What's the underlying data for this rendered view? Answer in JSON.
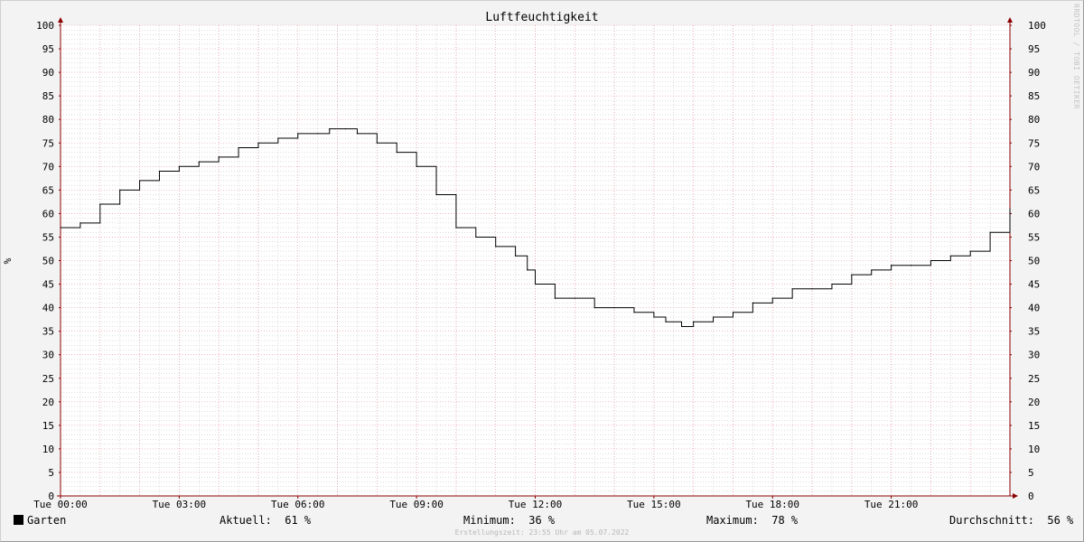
{
  "chart_data": {
    "type": "line",
    "title": "Luftfeuchtigkeit",
    "ylabel": "%",
    "xlabel": "",
    "ylim": [
      0,
      100
    ],
    "xlim": [
      0,
      24
    ],
    "y_ticks": [
      0,
      5,
      10,
      15,
      20,
      25,
      30,
      35,
      40,
      45,
      50,
      55,
      60,
      65,
      70,
      75,
      80,
      85,
      90,
      95,
      100
    ],
    "x_ticks": [
      {
        "x": 0,
        "label": "Tue 00:00"
      },
      {
        "x": 3,
        "label": "Tue 03:00"
      },
      {
        "x": 6,
        "label": "Tue 06:00"
      },
      {
        "x": 9,
        "label": "Tue 09:00"
      },
      {
        "x": 12,
        "label": "Tue 12:00"
      },
      {
        "x": 15,
        "label": "Tue 15:00"
      },
      {
        "x": 18,
        "label": "Tue 18:00"
      },
      {
        "x": 21,
        "label": "Tue 21:00"
      }
    ],
    "grid": true,
    "legend_position": "bottom-left",
    "colors": {
      "line": "#000000",
      "major_grid": "#e48a9a",
      "minor_grid": "#b8b8b8",
      "axis": "#8b0000",
      "plot_bg": "#ffffff"
    },
    "series": [
      {
        "name": "Garten",
        "color": "#000000",
        "x": [
          0,
          0.5,
          1.0,
          1.5,
          2.0,
          2.5,
          3.0,
          3.5,
          4.0,
          4.5,
          5.0,
          5.5,
          6.0,
          6.5,
          6.8,
          7.2,
          7.5,
          8.0,
          8.5,
          9.0,
          9.5,
          10.0,
          10.5,
          11.0,
          11.5,
          11.8,
          12.0,
          12.5,
          13.0,
          13.5,
          14.0,
          14.5,
          15.0,
          15.3,
          15.7,
          16.0,
          16.5,
          17.0,
          17.5,
          18.0,
          18.5,
          19.0,
          19.5,
          20.0,
          20.5,
          21.0,
          21.5,
          22.0,
          22.5,
          23.0,
          23.5,
          24.0
        ],
        "y": [
          57,
          58,
          62,
          65,
          67,
          69,
          70,
          71,
          72,
          74,
          75,
          76,
          77,
          77,
          78,
          78,
          77,
          75,
          73,
          70,
          64,
          57,
          55,
          53,
          51,
          48,
          45,
          42,
          42,
          40,
          40,
          39,
          38,
          37,
          36,
          37,
          38,
          39,
          41,
          42,
          44,
          44,
          45,
          47,
          48,
          49,
          49,
          50,
          51,
          52,
          56,
          61
        ]
      }
    ]
  },
  "legend": {
    "series_name": "Garten",
    "current_label": "Aktuell:",
    "current_value": "61 %",
    "min_label": "Minimum:",
    "min_value": "36 %",
    "max_label": "Maximum:",
    "max_value": "78 %",
    "avg_label": "Durchschnitt:",
    "avg_value": "56 %"
  },
  "footer": "Erstellungszeit: 23:55 Uhr am 05.07.2022",
  "watermark": "RRDTOOL / TOBI OETIKER"
}
